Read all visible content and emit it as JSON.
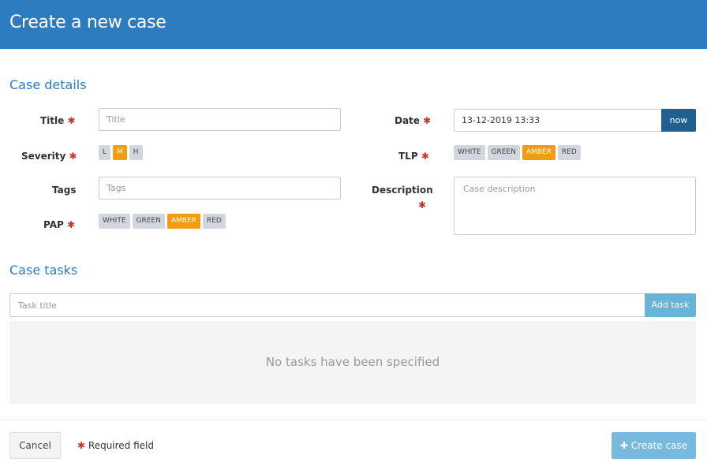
{
  "header": {
    "title": "Create a new case"
  },
  "case_details": {
    "section_title": "Case details",
    "title": {
      "label": "Title",
      "placeholder": "Title"
    },
    "severity": {
      "label": "Severity",
      "options": [
        "L",
        "M",
        "H"
      ],
      "selected": "M"
    },
    "tags": {
      "label": "Tags",
      "placeholder": "Tags"
    },
    "pap": {
      "label": "PAP",
      "options": [
        "WHITE",
        "GREEN",
        "AMBER",
        "RED"
      ],
      "selected": "AMBER"
    },
    "date": {
      "label": "Date",
      "value": "13-12-2019 13:33",
      "now_label": "now"
    },
    "tlp": {
      "label": "TLP",
      "options": [
        "WHITE",
        "GREEN",
        "AMBER",
        "RED"
      ],
      "selected": "AMBER"
    },
    "description": {
      "label": "Description",
      "placeholder": "Case description"
    },
    "required_marker": "✱"
  },
  "case_tasks": {
    "section_title": "Case tasks",
    "task_placeholder": "Task title",
    "add_task_label": "Add task",
    "empty_text": "No tasks have been specified"
  },
  "footer": {
    "cancel_label": "Cancel",
    "required_note": "Required field",
    "create_icon": "plus-icon",
    "create_label": "Create case"
  },
  "colors": {
    "header": "#2c7cbf",
    "accent_pill": "#f39c12",
    "required": "#c0392b",
    "now_button": "#1f5f92",
    "add_task_button": "#69b3d6",
    "create_button": "#7ab9de"
  }
}
